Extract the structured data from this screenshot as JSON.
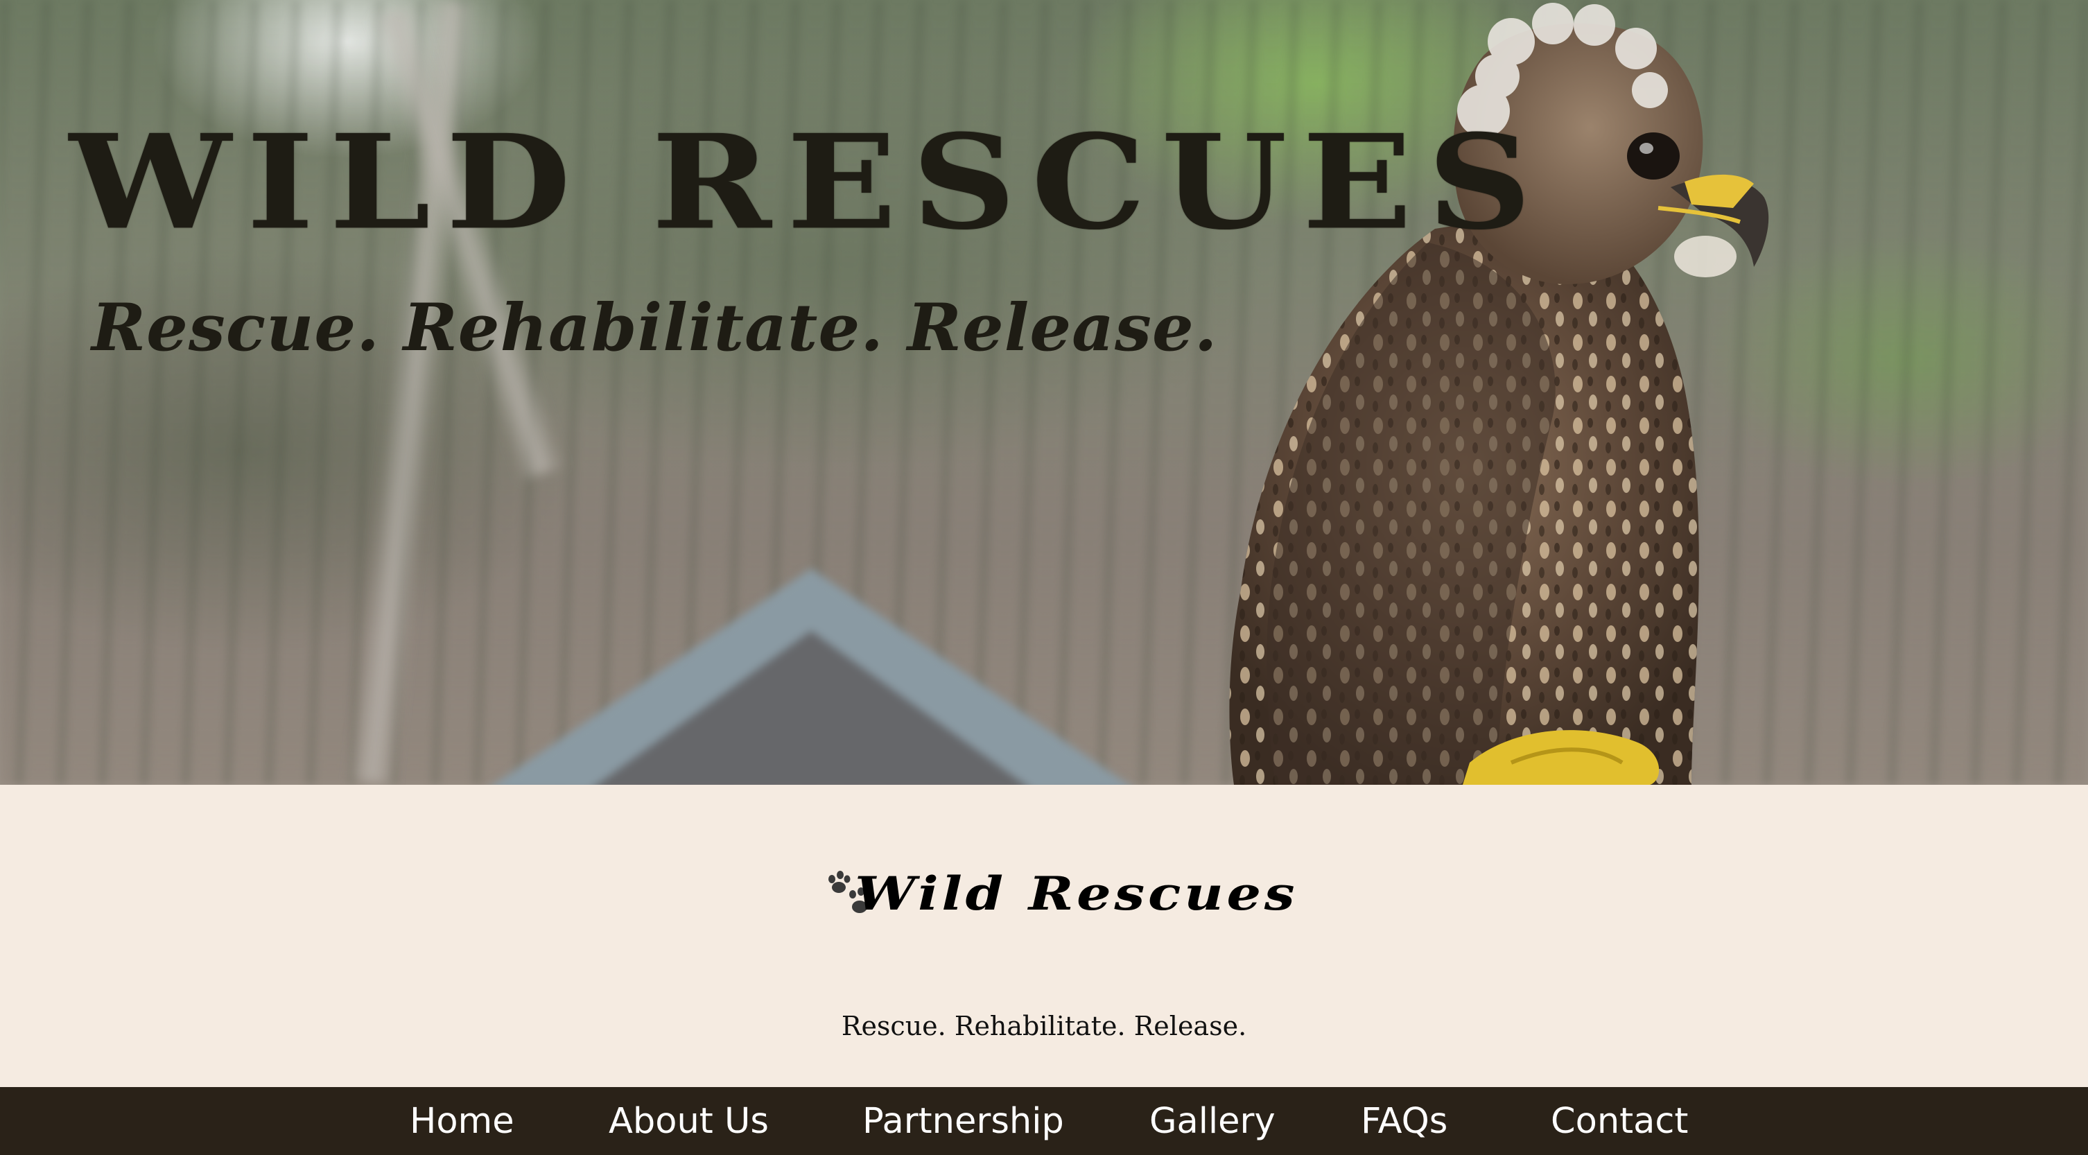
{
  "hero": {
    "title": "WILD RESCUES",
    "tagline": "Rescue. Rehabilitate. Release."
  },
  "brand": {
    "icon": "paw-prints-icon",
    "title": "Wild Rescues",
    "tagline": "Rescue. Rehabilitate. Release."
  },
  "nav": {
    "items": [
      {
        "label": "Home"
      },
      {
        "label": "About Us"
      },
      {
        "label": "Partnership"
      },
      {
        "label": "Gallery"
      },
      {
        "label": "FAQs"
      },
      {
        "label": "Contact"
      }
    ]
  },
  "colors": {
    "hero_text": "#1e1c14",
    "band_background": "#f5ebe1",
    "nav_background": "#2a2218",
    "nav_text": "#ffffff"
  }
}
